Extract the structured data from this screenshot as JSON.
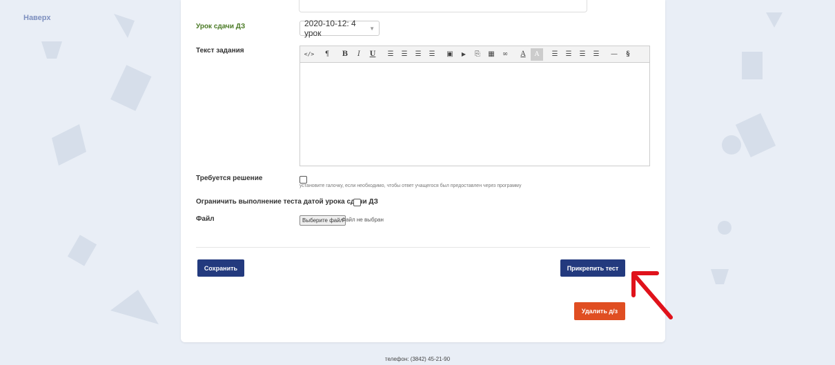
{
  "top_link": "Наверх",
  "form": {
    "lesson_label": "Урок сдачи ДЗ",
    "lesson_value": "2020-10-12: 4 урок",
    "task_text_label": "Текст задания",
    "solution_label": "Требуется решение",
    "solution_hint": "установите галочку, если необходимо, чтобы ответ учащегося был предоставлен через программу",
    "limit_label": "Ограничить выполнение теста датой урока сдачи ДЗ",
    "file_label": "Файл",
    "file_button": "Выберите файл",
    "file_status": "Файл не выбран"
  },
  "toolbar": {
    "code": "</>",
    "paragraph": "¶",
    "bold": "B",
    "italic": "I",
    "underline": "U",
    "ul": "☰",
    "ol": "☰",
    "outdent": "☰",
    "indent": "☰",
    "image": "▣",
    "video": "▶",
    "file": "⎘",
    "table": "▦",
    "link": "∞",
    "font_color": "A",
    "bg_color": "A",
    "align_left": "☰",
    "align_center": "☰",
    "align_right": "☰",
    "justify": "☰",
    "hr": "—",
    "source": "§"
  },
  "buttons": {
    "save": "Сохранить",
    "attach_test": "Прикрепить тест",
    "delete": "Удалить д/з"
  },
  "footer": "телефон: (3842) 45-21-90",
  "colors": {
    "primary": "#233a7e",
    "danger": "#e04e22",
    "arrow": "#e0121b",
    "label_green": "#4a7a25"
  }
}
